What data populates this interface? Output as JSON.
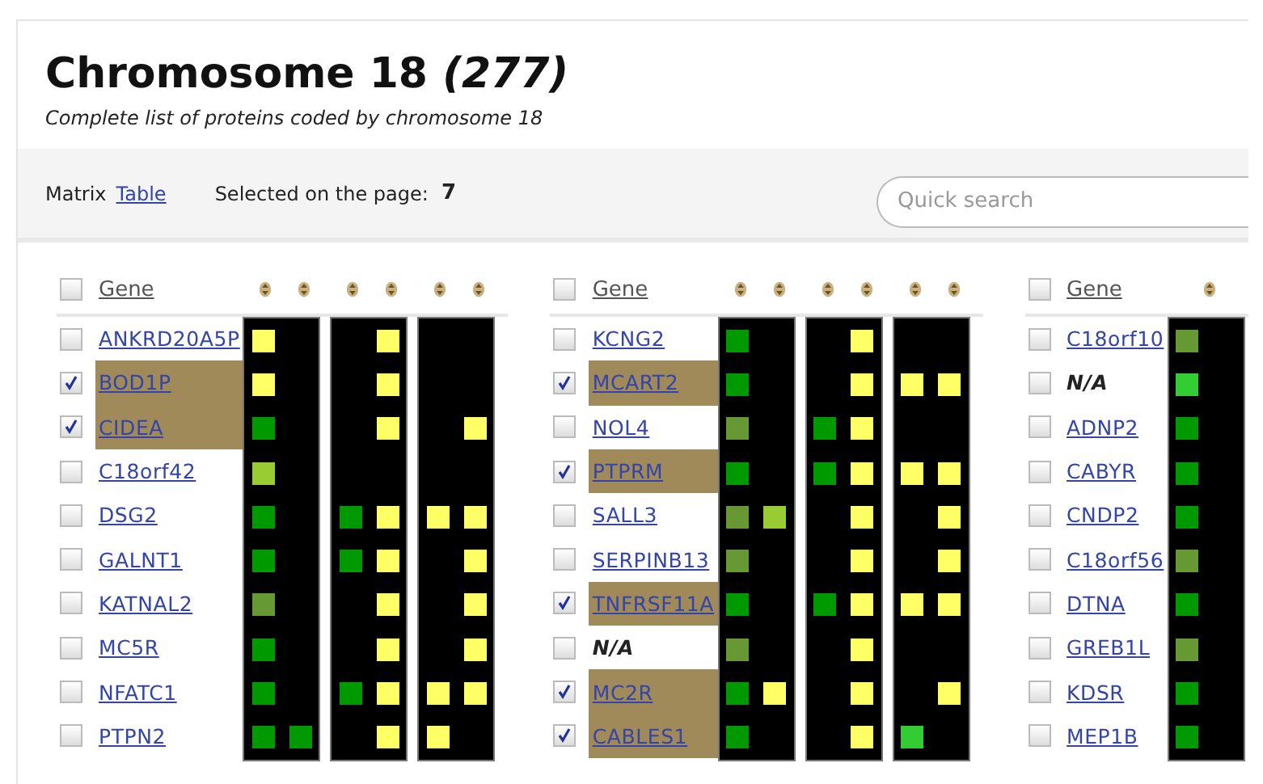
{
  "page": {
    "title": "Chromosome 18 *(277)*",
    "subtitle": "Complete list of proteins coded by chromosome 18"
  },
  "toolbar": {
    "views": [
      {
        "label": "Matrix",
        "selected": true
      },
      {
        "label": "Table",
        "selected": false
      }
    ],
    "selected_label": "Selected on the page:",
    "selected_count": "7",
    "search": {
      "placeholder": "Quick search"
    }
  },
  "matrix": {
    "blocks": [
      {
        "header": {
          "label": "Gene",
          "checked": false
        },
        "rows": [
          {
            "gene": "ANKRD20A5P",
            "kind": "link",
            "checked": false,
            "marks": [
              {
                "filled": true,
                "color": "#ffff66"
              },
              {
                "filled": false
              },
              {
                "filled": false
              },
              {
                "filled": true,
                "color": "#ffff66"
              },
              {
                "filled": false
              },
              {
                "filled": false
              }
            ]
          },
          {
            "gene": "BOD1P",
            "kind": "link",
            "checked": true,
            "marks": [
              {
                "filled": true,
                "color": "#ffff66"
              },
              {
                "filled": false
              },
              {
                "filled": false
              },
              {
                "filled": true,
                "color": "#ffff66"
              },
              {
                "filled": false
              },
              {
                "filled": false
              }
            ]
          },
          {
            "gene": "CIDEA",
            "kind": "link",
            "checked": true,
            "marks": [
              {
                "filled": true,
                "color": "#009900"
              },
              {
                "filled": false
              },
              {
                "filled": false
              },
              {
                "filled": true,
                "color": "#ffff66"
              },
              {
                "filled": false
              },
              {
                "filled": true,
                "color": "#ffff66"
              }
            ]
          },
          {
            "gene": "C18orf42",
            "kind": "link",
            "checked": false,
            "marks": [
              {
                "filled": true,
                "color": "#99cc33"
              },
              {
                "filled": false
              },
              {
                "filled": false
              },
              {
                "filled": false
              },
              {
                "filled": false
              },
              {
                "filled": false
              }
            ]
          },
          {
            "gene": "DSG2",
            "kind": "link",
            "checked": false,
            "marks": [
              {
                "filled": true,
                "color": "#009900"
              },
              {
                "filled": false
              },
              {
                "filled": true,
                "color": "#009900"
              },
              {
                "filled": true,
                "color": "#ffff66"
              },
              {
                "filled": true,
                "color": "#ffff66"
              },
              {
                "filled": true,
                "color": "#ffff66"
              }
            ]
          },
          {
            "gene": "GALNT1",
            "kind": "link",
            "checked": false,
            "marks": [
              {
                "filled": true,
                "color": "#009900"
              },
              {
                "filled": false
              },
              {
                "filled": true,
                "color": "#009900"
              },
              {
                "filled": true,
                "color": "#ffff66"
              },
              {
                "filled": false
              },
              {
                "filled": true,
                "color": "#ffff66"
              }
            ]
          },
          {
            "gene": "KATNAL2",
            "kind": "link",
            "checked": false,
            "marks": [
              {
                "filled": true,
                "color": "#669933"
              },
              {
                "filled": false
              },
              {
                "filled": false
              },
              {
                "filled": true,
                "color": "#ffff66"
              },
              {
                "filled": false
              },
              {
                "filled": true,
                "color": "#ffff66"
              }
            ]
          },
          {
            "gene": "MC5R",
            "kind": "link",
            "checked": false,
            "marks": [
              {
                "filled": true,
                "color": "#009900"
              },
              {
                "filled": false
              },
              {
                "filled": false
              },
              {
                "filled": true,
                "color": "#ffff66"
              },
              {
                "filled": false
              },
              {
                "filled": true,
                "color": "#ffff66"
              }
            ]
          },
          {
            "gene": "NFATC1",
            "kind": "link",
            "checked": false,
            "marks": [
              {
                "filled": true,
                "color": "#009900"
              },
              {
                "filled": false
              },
              {
                "filled": true,
                "color": "#009900"
              },
              {
                "filled": true,
                "color": "#ffff66"
              },
              {
                "filled": true,
                "color": "#ffff66"
              },
              {
                "filled": true,
                "color": "#ffff66"
              }
            ]
          },
          {
            "gene": "PTPN2",
            "kind": "link",
            "checked": false,
            "marks": [
              {
                "filled": true,
                "color": "#009900"
              },
              {
                "filled": true,
                "color": "#009900"
              },
              {
                "filled": false
              },
              {
                "filled": true,
                "color": "#ffff66"
              },
              {
                "filled": true,
                "color": "#ffff66"
              },
              {
                "filled": false
              }
            ]
          }
        ]
      },
      {
        "header": {
          "label": "Gene",
          "checked": false
        },
        "rows": [
          {
            "gene": "KCNG2",
            "kind": "link",
            "checked": false,
            "marks": [
              {
                "filled": true,
                "color": "#009900"
              },
              {
                "filled": false
              },
              {
                "filled": false
              },
              {
                "filled": true,
                "color": "#ffff66"
              },
              {
                "filled": false
              },
              {
                "filled": false
              }
            ]
          },
          {
            "gene": "MCART2",
            "kind": "link",
            "checked": true,
            "marks": [
              {
                "filled": true,
                "color": "#009900"
              },
              {
                "filled": false
              },
              {
                "filled": false
              },
              {
                "filled": true,
                "color": "#ffff66"
              },
              {
                "filled": true,
                "color": "#ffff66"
              },
              {
                "filled": true,
                "color": "#ffff66"
              }
            ]
          },
          {
            "gene": "NOL4",
            "kind": "link",
            "checked": false,
            "marks": [
              {
                "filled": true,
                "color": "#669933"
              },
              {
                "filled": false
              },
              {
                "filled": true,
                "color": "#009900"
              },
              {
                "filled": true,
                "color": "#ffff66"
              },
              {
                "filled": false
              },
              {
                "filled": false
              }
            ]
          },
          {
            "gene": "PTPRM",
            "kind": "link",
            "checked": true,
            "marks": [
              {
                "filled": true,
                "color": "#009900"
              },
              {
                "filled": false
              },
              {
                "filled": true,
                "color": "#009900"
              },
              {
                "filled": true,
                "color": "#ffff66"
              },
              {
                "filled": true,
                "color": "#ffff66"
              },
              {
                "filled": true,
                "color": "#ffff66"
              }
            ]
          },
          {
            "gene": "SALL3",
            "kind": "link",
            "checked": false,
            "marks": [
              {
                "filled": true,
                "color": "#669933"
              },
              {
                "filled": true,
                "color": "#99cc33"
              },
              {
                "filled": false
              },
              {
                "filled": true,
                "color": "#ffff66"
              },
              {
                "filled": false
              },
              {
                "filled": true,
                "color": "#ffff66"
              }
            ]
          },
          {
            "gene": "SERPINB13",
            "kind": "link",
            "checked": false,
            "marks": [
              {
                "filled": true,
                "color": "#669933"
              },
              {
                "filled": false
              },
              {
                "filled": false
              },
              {
                "filled": true,
                "color": "#ffff66"
              },
              {
                "filled": false
              },
              {
                "filled": true,
                "color": "#ffff66"
              }
            ]
          },
          {
            "gene": "TNFRSF11A",
            "kind": "link",
            "checked": true,
            "marks": [
              {
                "filled": true,
                "color": "#009900"
              },
              {
                "filled": false
              },
              {
                "filled": true,
                "color": "#009900"
              },
              {
                "filled": true,
                "color": "#ffff66"
              },
              {
                "filled": true,
                "color": "#ffff66"
              },
              {
                "filled": true,
                "color": "#ffff66"
              }
            ]
          },
          {
            "gene": "N/A",
            "kind": "text",
            "checked": false,
            "marks": [
              {
                "filled": true,
                "color": "#669933"
              },
              {
                "filled": false
              },
              {
                "filled": false
              },
              {
                "filled": true,
                "color": "#ffff66"
              },
              {
                "filled": false
              },
              {
                "filled": false
              }
            ]
          },
          {
            "gene": "MC2R",
            "kind": "link",
            "checked": true,
            "marks": [
              {
                "filled": true,
                "color": "#009900"
              },
              {
                "filled": true,
                "color": "#ffff66"
              },
              {
                "filled": false
              },
              {
                "filled": true,
                "color": "#ffff66"
              },
              {
                "filled": false
              },
              {
                "filled": true,
                "color": "#ffff66"
              }
            ]
          },
          {
            "gene": "CABLES1",
            "kind": "link",
            "checked": true,
            "marks": [
              {
                "filled": true,
                "color": "#009900"
              },
              {
                "filled": false
              },
              {
                "filled": false
              },
              {
                "filled": true,
                "color": "#ffff66"
              },
              {
                "filled": true,
                "color": "#33cc33"
              },
              {
                "filled": false
              }
            ]
          }
        ]
      },
      {
        "header": {
          "label": "Gene",
          "checked": false
        },
        "rows": [
          {
            "gene": "C18orf10",
            "kind": "link",
            "checked": false,
            "marks": [
              {
                "filled": true,
                "color": "#669933"
              }
            ]
          },
          {
            "gene": "N/A",
            "kind": "text",
            "checked": false,
            "marks": [
              {
                "filled": true,
                "color": "#33cc33"
              }
            ]
          },
          {
            "gene": "ADNP2",
            "kind": "link",
            "checked": false,
            "marks": [
              {
                "filled": true,
                "color": "#009900"
              }
            ]
          },
          {
            "gene": "CABYR",
            "kind": "link",
            "checked": false,
            "marks": [
              {
                "filled": true,
                "color": "#009900"
              }
            ]
          },
          {
            "gene": "CNDP2",
            "kind": "link",
            "checked": false,
            "marks": [
              {
                "filled": true,
                "color": "#009900"
              }
            ]
          },
          {
            "gene": "C18orf56",
            "kind": "link",
            "checked": false,
            "marks": [
              {
                "filled": true,
                "color": "#669933"
              }
            ]
          },
          {
            "gene": "DTNA",
            "kind": "link",
            "checked": false,
            "marks": [
              {
                "filled": true,
                "color": "#009900"
              }
            ]
          },
          {
            "gene": "GREB1L",
            "kind": "link",
            "checked": false,
            "marks": [
              {
                "filled": true,
                "color": "#669933"
              }
            ]
          },
          {
            "gene": "KDSR",
            "kind": "link",
            "checked": false,
            "marks": [
              {
                "filled": true,
                "color": "#009900"
              }
            ]
          },
          {
            "gene": "MEP1B",
            "kind": "link",
            "checked": false,
            "marks": [
              {
                "filled": true,
                "color": "#009900"
              }
            ]
          }
        ]
      }
    ]
  }
}
